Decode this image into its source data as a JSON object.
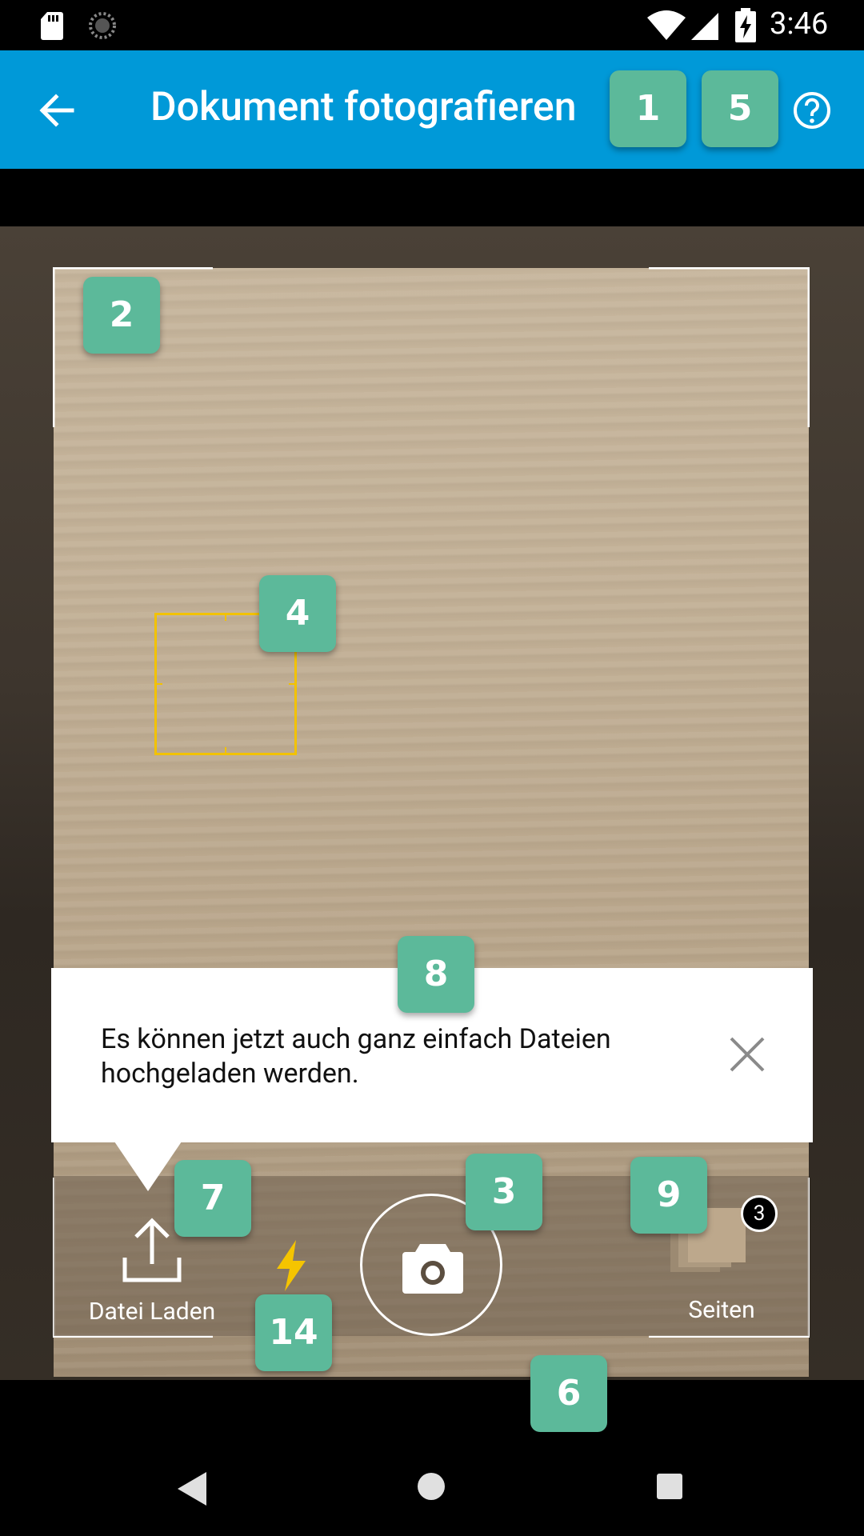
{
  "status_bar": {
    "time": "3:46"
  },
  "app_bar": {
    "title": "Dokument fotografieren"
  },
  "tooltip": {
    "text": "Es können jetzt auch ganz einfach Dateien hochgeladen werden."
  },
  "toolbar": {
    "upload_label": "Datei Laden",
    "pages_label": "Seiten",
    "pages_count": "3"
  },
  "badges": {
    "b1": "1",
    "b2": "2",
    "b3": "3",
    "b4": "4",
    "b5": "5",
    "b6": "6",
    "b7": "7",
    "b8": "8",
    "b9": "9",
    "b14": "14"
  },
  "colors": {
    "app_bar": "#0099d8",
    "badge": "#5cb99a",
    "focus": "#f2c200",
    "flash": "#f5c400"
  },
  "icons": [
    "sd-card-icon",
    "sync-icon",
    "wifi-icon",
    "signal-icon",
    "battery-charging-icon",
    "back-arrow-icon",
    "help-icon",
    "upload-icon",
    "flash-icon",
    "camera-icon",
    "close-icon",
    "nav-back-icon",
    "nav-home-icon",
    "nav-recents-icon"
  ]
}
